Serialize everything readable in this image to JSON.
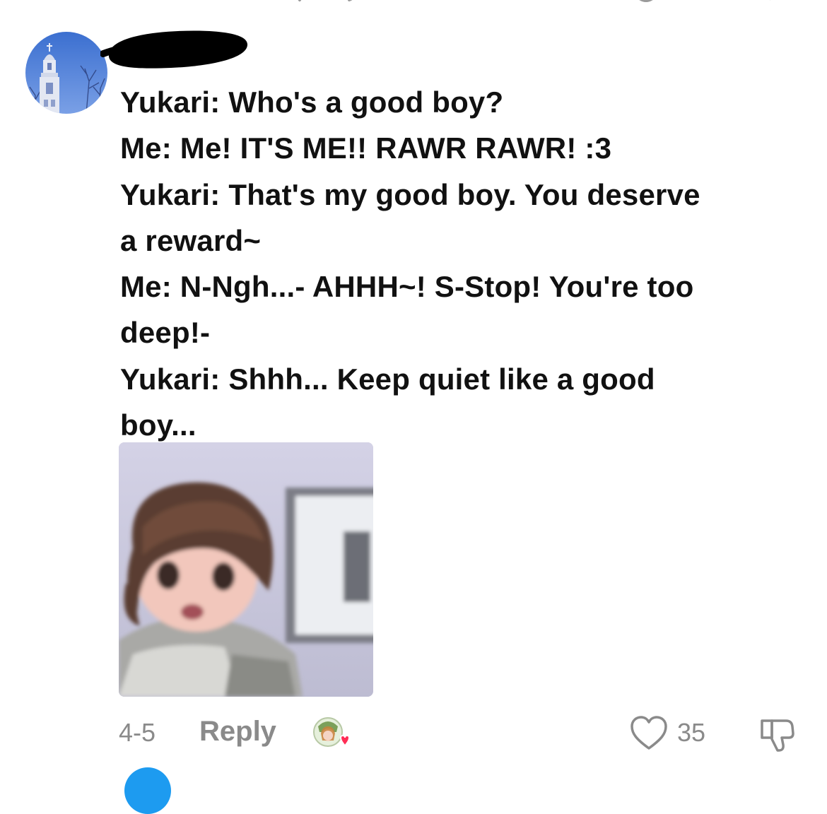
{
  "comment": {
    "lines": [
      "Yukari: Who's a good boy?",
      "Me: Me! IT'S ME!! RAWR RAWR! :3",
      "Yukari: That's my good boy. You deserve",
      "a reward~",
      "Me: N-Ngh...- AHHH~! S-Stop! You're too",
      "deep!-",
      "Yukari: Shhh... Keep quiet like a good",
      "boy..."
    ]
  },
  "footer": {
    "date": "4-5",
    "reply_label": "Reply",
    "like_count": "35"
  },
  "icons": {
    "like": "heart-outline-icon",
    "dislike": "thumbs-down-icon",
    "author_like_badge": "creator-liked-avatar-icon"
  },
  "colors": {
    "text": "#111111",
    "muted": "#8a8a8a",
    "heart_badge": "#ff2d55",
    "next_avatar": "#1d9bf0"
  }
}
